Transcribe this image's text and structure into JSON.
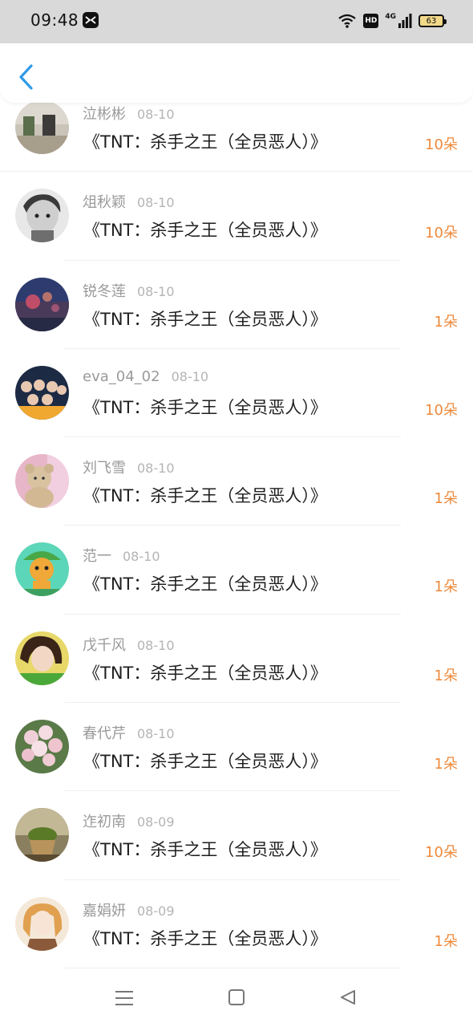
{
  "status_bar": {
    "time": "09:48",
    "hd": "HD",
    "network": "4G",
    "battery": "63"
  },
  "header": {
    "back_icon": "chevron-left-icon"
  },
  "items": [
    {
      "user": "泣彬彬",
      "date": "08-10",
      "title": "《TNT：杀手之王（全员恶人）》",
      "flowers": "10朵"
    },
    {
      "user": "俎秋颖",
      "date": "08-10",
      "title": "《TNT：杀手之王（全员恶人）》",
      "flowers": "10朵"
    },
    {
      "user": "锐冬莲",
      "date": "08-10",
      "title": "《TNT：杀手之王（全员恶人）》",
      "flowers": "1朵"
    },
    {
      "user": "eva_04_02",
      "date": "08-10",
      "title": "《TNT：杀手之王（全员恶人）》",
      "flowers": "10朵"
    },
    {
      "user": "刘飞雪",
      "date": "08-10",
      "title": "《TNT：杀手之王（全员恶人）》",
      "flowers": "1朵"
    },
    {
      "user": "范一",
      "date": "08-10",
      "title": "《TNT：杀手之王（全员恶人）》",
      "flowers": "1朵"
    },
    {
      "user": "戊千风",
      "date": "08-10",
      "title": "《TNT：杀手之王（全员恶人）》",
      "flowers": "1朵"
    },
    {
      "user": "春代芹",
      "date": "08-10",
      "title": "《TNT：杀手之王（全员恶人）》",
      "flowers": "1朵"
    },
    {
      "user": "迮初南",
      "date": "08-09",
      "title": "《TNT：杀手之王（全员恶人）》",
      "flowers": "10朵"
    },
    {
      "user": "嘉娟妍",
      "date": "08-09",
      "title": "《TNT：杀手之王（全员恶人）》",
      "flowers": "1朵"
    }
  ],
  "nav": {
    "menu_icon": "menu-icon",
    "home_icon": "home-square-icon",
    "back_icon": "back-triangle-icon"
  },
  "colors": {
    "accent": "#2f9be8",
    "flowers": "#ee8a3c",
    "status_bar": "#d9d9d9"
  }
}
